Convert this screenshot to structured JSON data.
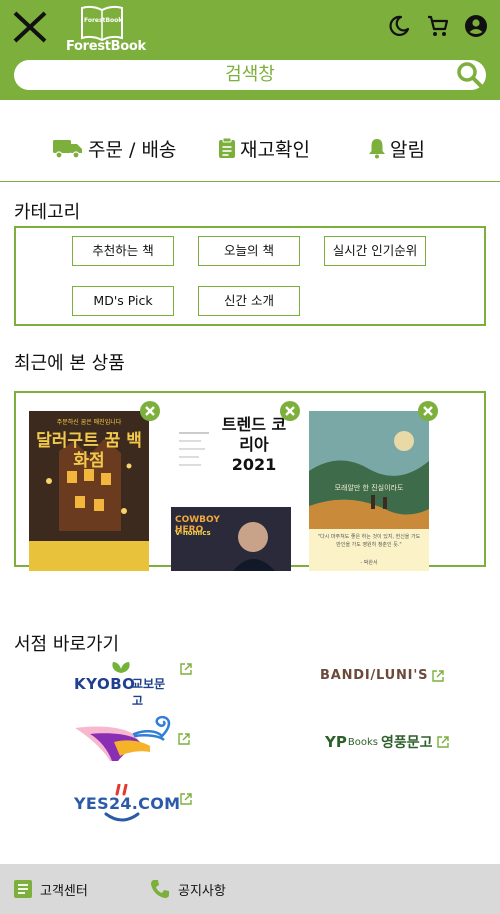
{
  "header": {
    "logo_text": "ForestBook",
    "logo_book_text": "ForestBook",
    "search_placeholder": "검색창"
  },
  "quick_menu": {
    "order_label": "주문 / 배송",
    "stock_label": "재고확인",
    "alarm_label": "알림"
  },
  "categories": {
    "title": "카테고리",
    "items": [
      "추천하는 책",
      "오늘의 책",
      "실시간 인기순위",
      "MD's Pick",
      "신간 소개"
    ]
  },
  "recent": {
    "title": "최근에 본 상품",
    "books": [
      {
        "title": "달러구트 꿈 백화점",
        "subtitle": "주문하신 꿈은 매진입니다"
      },
      {
        "title": "트렌드 코리아 2021",
        "subtitle": "COWBOY HERO",
        "subtitle2": "V-nomics"
      },
      {
        "title": "모래알만 한 진실이라도",
        "quote": "\"다시 마주쳐도 좋은 하는 것이 있지, 헌신을 가도 만인을 가도 영원히 청춘인 듯.\"",
        "quote_author": "- 박완서"
      }
    ]
  },
  "stores": {
    "title": "서점 바로가기",
    "kyobo": {
      "brand": "KYOBO",
      "korean": "교보문고"
    },
    "bandi": "BANDI/LUNI'S",
    "aladin": "aladin",
    "yp": {
      "brand": "YP",
      "sub": "Books",
      "korean": "영풍문고"
    },
    "yes24": "YES24.COM"
  },
  "footer": {
    "service": "고객센터",
    "notice": "공지사항"
  },
  "colors": {
    "accent": "#7daf3c",
    "footer_bg": "#d9d9d9"
  }
}
